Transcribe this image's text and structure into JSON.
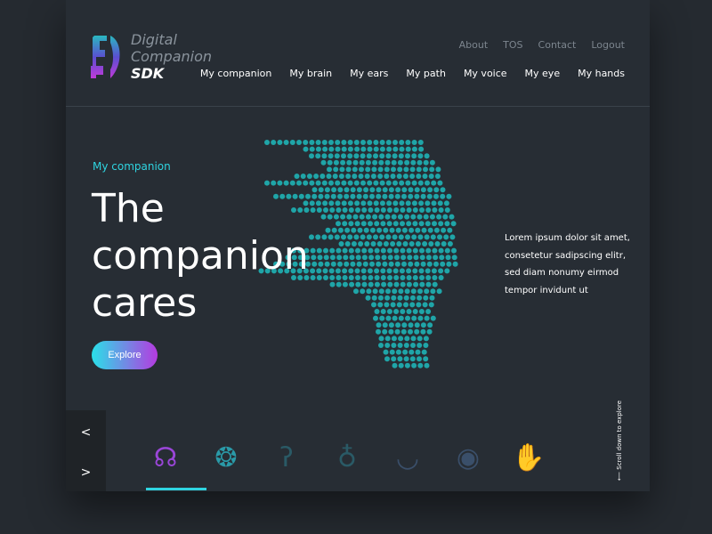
{
  "brand": {
    "line1": "Digital",
    "line2": "Companion",
    "line3": "SDK"
  },
  "secondary_nav": [
    "About",
    "TOS",
    "Contact",
    "Logout"
  ],
  "main_nav": [
    "My companion",
    "My brain",
    "My ears",
    "My path",
    "My voice",
    "My eye",
    "My hands"
  ],
  "hero": {
    "eyebrow": "My companion",
    "title_lines": [
      "The",
      "companion",
      "cares"
    ],
    "button": "Explore",
    "description": "Lorem ipsum dolor sit amet, consetetur sadipscing elitr, sed diam nonumy eirmod tempor invidunt ut"
  },
  "carousel": {
    "prev": "<",
    "next": ">",
    "items": [
      "companion-head-icon",
      "brain-icon",
      "ear-icon",
      "foot-icon",
      "lips-icon",
      "eye-icon",
      "hands-icon"
    ],
    "active_index": 0
  },
  "scroll_hint": "⟵ Scroll down to explore",
  "colors": {
    "accent": "#2fd4e0",
    "gradient_end": "#b53ae0",
    "dots": "#1fa5a8"
  }
}
